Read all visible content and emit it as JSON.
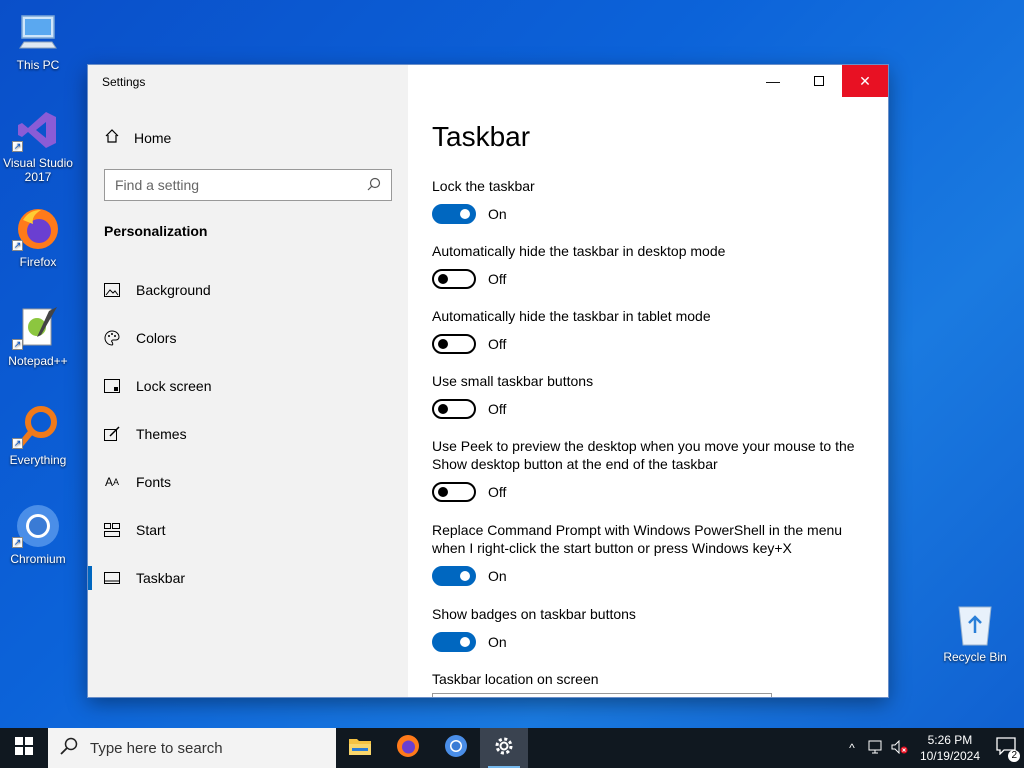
{
  "desktop": {
    "icons": [
      {
        "label": "This PC",
        "icon": "computer-icon"
      },
      {
        "label": "Visual Studio 2017",
        "icon": "visual-studio-icon"
      },
      {
        "label": "Firefox",
        "icon": "firefox-icon"
      },
      {
        "label": "Notepad++",
        "icon": "notepadpp-icon"
      },
      {
        "label": "Everything",
        "icon": "everything-icon"
      },
      {
        "label": "Chromium",
        "icon": "chromium-icon"
      },
      {
        "label": "Recycle Bin",
        "icon": "recycle-bin-icon"
      }
    ]
  },
  "window": {
    "app_title": "Settings",
    "home_label": "Home",
    "search_placeholder": "Find a setting",
    "section_title": "Personalization",
    "nav": [
      {
        "label": "Background",
        "icon": "picture-icon"
      },
      {
        "label": "Colors",
        "icon": "palette-icon"
      },
      {
        "label": "Lock screen",
        "icon": "lock-screen-icon"
      },
      {
        "label": "Themes",
        "icon": "themes-icon"
      },
      {
        "label": "Fonts",
        "icon": "fonts-icon"
      },
      {
        "label": "Start",
        "icon": "start-icon"
      },
      {
        "label": "Taskbar",
        "icon": "taskbar-icon",
        "active": true
      }
    ],
    "page_title": "Taskbar",
    "settings": [
      {
        "label": "Lock the taskbar",
        "state": "On",
        "on": true
      },
      {
        "label": "Automatically hide the taskbar in desktop mode",
        "state": "Off",
        "on": false
      },
      {
        "label": "Automatically hide the taskbar in tablet mode",
        "state": "Off",
        "on": false
      },
      {
        "label": "Use small taskbar buttons",
        "state": "Off",
        "on": false
      },
      {
        "label": "Use Peek to preview the desktop when you move your mouse to the Show desktop button at the end of the taskbar",
        "state": "Off",
        "on": false
      },
      {
        "label": "Replace Command Prompt with Windows PowerShell in the menu when I right-click the start button or press Windows key+X",
        "state": "On",
        "on": true
      },
      {
        "label": "Show badges on taskbar buttons",
        "state": "On",
        "on": true
      }
    ],
    "location_label": "Taskbar location on screen"
  },
  "taskbar": {
    "search_placeholder": "Type here to search",
    "apps": [
      "file-explorer-icon",
      "firefox-icon",
      "chromium-icon",
      "settings-gear-icon"
    ],
    "time": "5:26 PM",
    "date": "10/19/2024",
    "notification_count": "2"
  },
  "colors": {
    "accent": "#0067c0",
    "close": "#e81123",
    "taskbar": "#101820"
  }
}
